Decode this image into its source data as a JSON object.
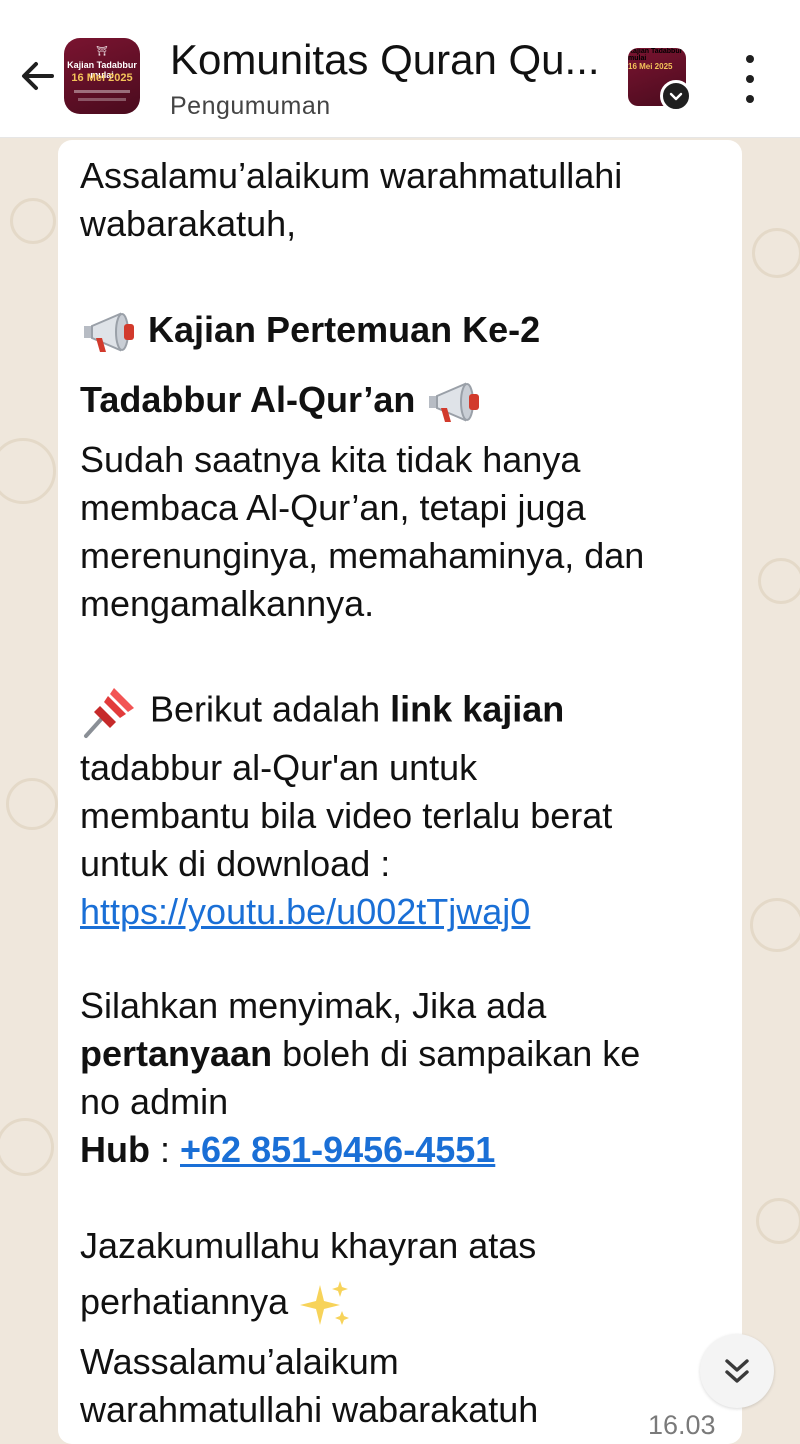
{
  "header": {
    "title": "Komunitas Quran Qu...",
    "subtitle": "Pengumuman",
    "avatar_text": "Kajian Tadabbur mulai",
    "avatar_date": "16 Mei 2025",
    "avatar2_text": "Kajian Tadabbur mulai",
    "avatar2_date": "16 Mei 2025"
  },
  "message": {
    "line1": "Assalamu’alaikum warahmatullahi",
    "line2": "wabarakatuh,",
    "heading1": "Kajian Pertemuan Ke-2",
    "heading2": "Tadabbur Al-Qur’an",
    "p1_l1": "Sudah saatnya kita tidak hanya",
    "p1_l2": "membaca Al-Qur’an, tetapi juga",
    "p1_l3": "merenunginya, memahaminya, dan",
    "p1_l4": "mengamalkannya.",
    "p2_pre": "Berikut adalah ",
    "p2_bold": "link kajian",
    "p2_l2": "tadabbur al-Qur'an untuk",
    "p2_l3": "membantu bila video terlalu berat",
    "p2_l4": "untuk di download :",
    "link": "https://youtu.be/u002tTjwaj0",
    "p3_l1": "Silahkan menyimak, Jika ada",
    "p3_bold": "pertanyaan",
    "p3_l2_rest": " boleh di sampaikan ke",
    "p3_l3": "no admin",
    "hub_label": "Hub",
    "hub_sep": " : ",
    "phone": "+62 851-9456-4551",
    "p4_l1": "Jazakumullahu khayran atas",
    "p4_l2": "perhatiannya",
    "p5_l1": "Wassalamu’alaikum",
    "p5_l2": "warahmatullahi wabarakatuh",
    "time": "16.03"
  },
  "icons": {
    "back": "arrow-left-icon",
    "menu": "more-vertical-icon",
    "megaphone": "megaphone-icon",
    "pin": "pushpin-icon",
    "sparkles": "sparkles-icon",
    "scroll_down": "double-chevron-down-icon"
  },
  "colors": {
    "link": "#1a6fd6",
    "chat_bg": "#efe7dc",
    "avatar": "#6b1028"
  }
}
